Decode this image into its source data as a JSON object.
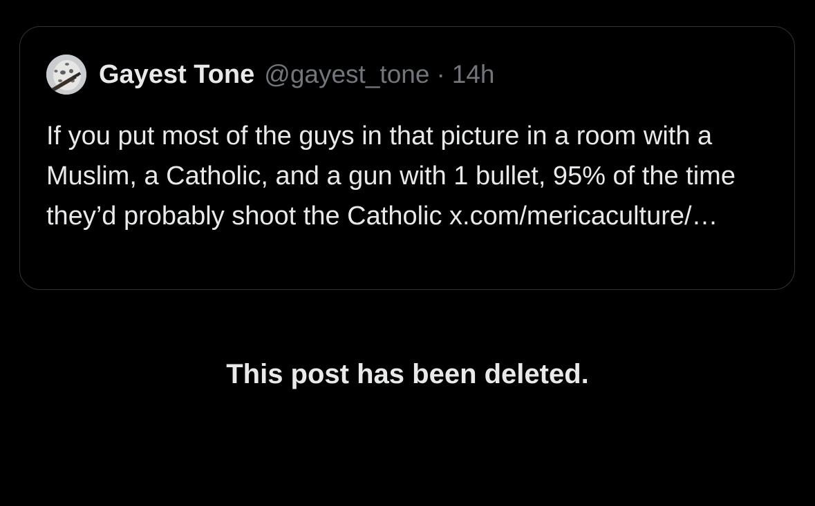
{
  "quote": {
    "author_name": "Gayest Tone",
    "author_handle": "@gayest_tone",
    "separator": "·",
    "time": "14h",
    "avatar_icon": "snow-leopard-avatar",
    "text": "If you put most of the guys in that picture in a room with a Muslim, a Catholic, and a gun with 1 bullet, 95% of the time they’d probably shoot the Catholic x.com/mericaculture/…"
  },
  "notice": {
    "text": "This post has been deleted."
  },
  "colors": {
    "background": "#000000",
    "text_primary": "#e7e9ea",
    "text_secondary": "#71767b",
    "border": "#2f3336"
  }
}
